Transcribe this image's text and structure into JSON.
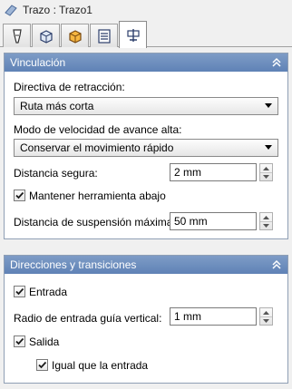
{
  "window": {
    "title": "Trazo : Trazo1"
  },
  "tabs": [
    {
      "name": "tool",
      "icon": "tool-icon"
    },
    {
      "name": "stock",
      "icon": "stock-box-icon"
    },
    {
      "name": "limits",
      "icon": "limits-box-icon"
    },
    {
      "name": "parameters",
      "icon": "parameters-list-icon"
    },
    {
      "name": "linking",
      "icon": "linking-icon",
      "active": true
    }
  ],
  "vinculacion": {
    "title": "Vinculación",
    "retract_label": "Directiva de retracción:",
    "retract_value": "Ruta más corta",
    "feed_label": "Modo de velocidad de avance alta:",
    "feed_value": "Conservar el movimiento rápido",
    "safe_label": "Distancia segura:",
    "safe_value": "2 mm",
    "keep_tool_label": "Mantener herramienta abajo",
    "keep_tool_checked": true,
    "max_stay_label": "Distancia de suspensión máxima:",
    "max_stay_value": "50 mm"
  },
  "direcciones": {
    "title": "Direcciones y transiciones",
    "entry_label": "Entrada",
    "entry_checked": true,
    "radius_label": "Radio de entrada guía vertical:",
    "radius_value": "1 mm",
    "exit_label": "Salida",
    "exit_checked": true,
    "same_label": "Igual que la entrada",
    "same_checked": true
  }
}
